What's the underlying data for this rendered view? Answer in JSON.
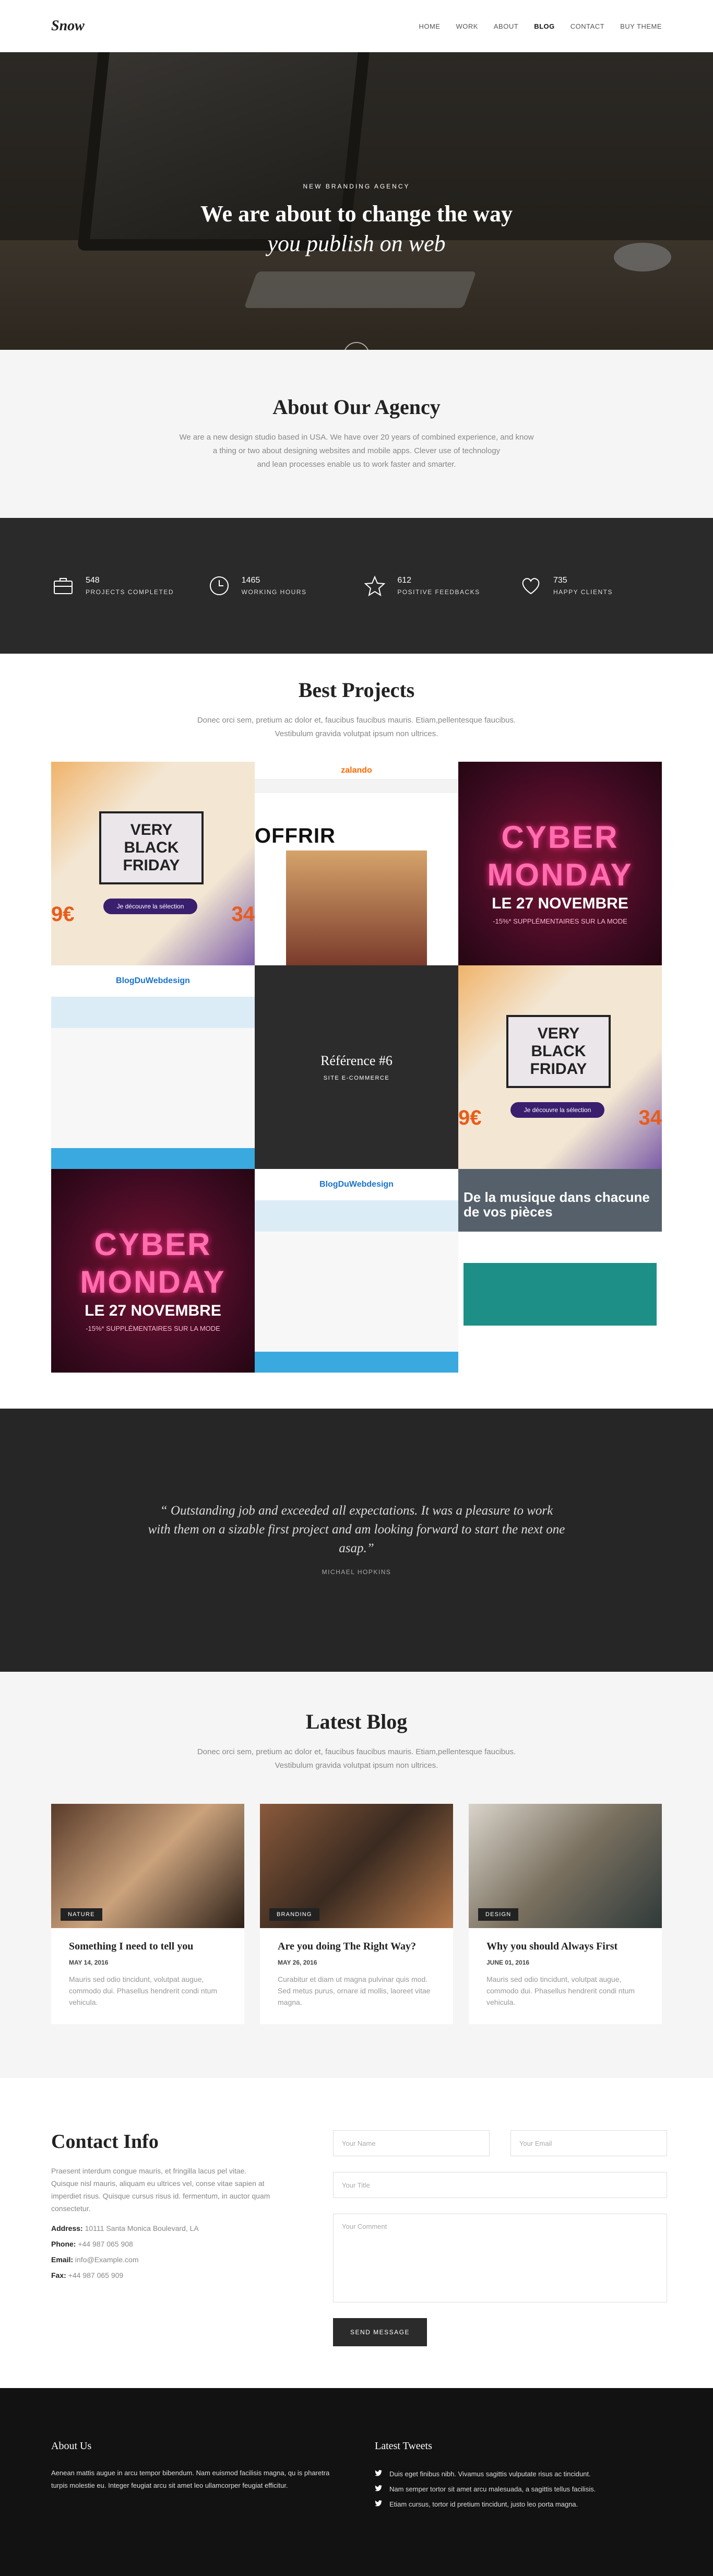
{
  "header": {
    "logo": "Snow",
    "nav": [
      "HOME",
      "WORK",
      "ABOUT",
      "BLOG",
      "CONTACT",
      "BUY THEME"
    ]
  },
  "hero": {
    "kicker": "NEW BRANDING AGENCY",
    "title": "We are about to change the way",
    "subtitle": "you publish on web",
    "down_icon": "chevron-down"
  },
  "about": {
    "title": "About Our Agency",
    "text1": "We are a new design studio based in USA. We have over 20 years of combined experience, and know",
    "text2": "a thing or two about designing websites and mobile apps. Clever use of technology",
    "text3": "and lean processes enable us to work faster and smarter."
  },
  "stats": [
    {
      "num": "548",
      "label": "PROJECTS COMPLETED",
      "icon": "briefcase"
    },
    {
      "num": "1465",
      "label": "WORKING HOURS",
      "icon": "clock"
    },
    {
      "num": "612",
      "label": "POSITIVE FEEDBACKS",
      "icon": "star"
    },
    {
      "num": "735",
      "label": "HAPPY CLIENTS",
      "icon": "heart"
    }
  ],
  "projects": {
    "title": "Best Projects",
    "text1": "Donec orci sem, pretium ac dolor et, faucibus faucibus mauris. Etiam,pellentesque faucibus.",
    "text2": "Vestibulum gravida volutpat ipsum non ultrices.",
    "tiles": {
      "bf_line1": "VERY",
      "bf_line2": "BLACK",
      "bf_line3": "FRIDAY",
      "bf_pill": "Je découvre la sélection",
      "bf_price1": "9€",
      "bf_price2": "34",
      "cm_line1": "CYBER",
      "cm_line2": "MONDAY",
      "cm_line3": "LE 27 NOVEMBRE",
      "cm_line4": "-15%* SUPPLÉMENTAIRES SUR LA MODE",
      "za_brand": "zalando",
      "za_text": "OFFRIR",
      "wd_brand": "BlogDuWebdesign",
      "ref_title": "Référence #6",
      "ref_cat": "SITE E-COMMERCE",
      "mu_text": "De la musique dans chacune de vos pièces"
    }
  },
  "testimonial": {
    "quote": "“ Outstanding job and exceeded all expectations. It was a pleasure to work with them on a sizable first project and am looking forward to start the next one asap.”",
    "author": "MICHAEL HOPKINS"
  },
  "blog": {
    "title": "Latest Blog",
    "text1": "Donec orci sem, pretium ac dolor et, faucibus faucibus mauris. Etiam,pellentesque faucibus.",
    "text2": "Vestibulum gravida volutpat ipsum non ultrices.",
    "posts": [
      {
        "tag": "NATURE",
        "title": "Something I need to tell you",
        "date": "MAY 14, 2016",
        "excerpt": "Mauris sed odio tincidunt, volutpat augue, commodo dui. Phasellus hendrerit condi ntum vehicula."
      },
      {
        "tag": "BRANDING",
        "title": "Are you doing The Right Way?",
        "date": "MAY 26, 2016",
        "excerpt": "Curabitur et diam ut magna pulvinar quis mod. Sed metus purus, ornare id mollis, laoreet vitae magna."
      },
      {
        "tag": "DESIGN",
        "title": "Why you should Always First",
        "date": "JUNE 01, 2016",
        "excerpt": "Mauris sed odio tincidunt, volutpat augue, commodo dui. Phasellus hendrerit condi ntum vehicula."
      }
    ]
  },
  "contact": {
    "title": "Contact Info",
    "text": "Praesent interdum congue mauris, et fringilla lacus pel vitae. Quisque nisl mauris, aliquam eu ultrices vel, conse vitae sapien at imperdiet risus. Quisque cursus risus id. fermentum, in auctor quam consectetur.",
    "address_label": "Address:",
    "address": "10111 Santa Monica Boulevard, LA",
    "phone_label": "Phone:",
    "phone": "+44 987 065 908",
    "email_label": "Email:",
    "email": "info@Example.com",
    "fax_label": "Fax:",
    "fax": "+44 987 065 909",
    "form": {
      "name": "Your Name",
      "email": "Your Email",
      "title": "Your Title",
      "comment": "Your Comment",
      "send": "SEND MESSAGE"
    }
  },
  "footer": {
    "about_title": "About Us",
    "about_text": "Aenean mattis augue in arcu tempor bibendum. Nam euismod facilisis magna, qu is pharetra turpis molestie eu. Integer feugiat arcu sit amet leo ullamcorper feugiat efficitur.",
    "tweets_title": "Latest Tweets",
    "tweets": [
      "Duis eget finibus nibh. Vivamus sagittis vulputate risus ac tincidunt.",
      "Nam semper tortor sit amet arcu malesuada, a sagittis tellus facilisis.",
      "Etiam cursus, tortor id pretium tincidunt, justo leo porta magna."
    ]
  }
}
